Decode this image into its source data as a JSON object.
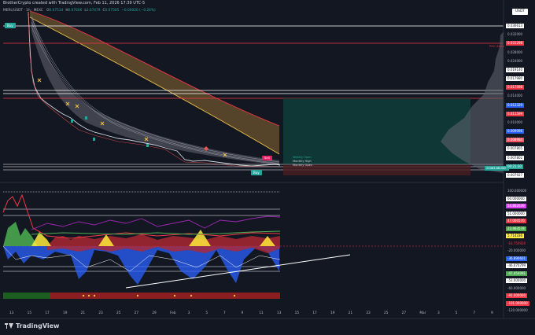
{
  "header": {
    "title": "BrotherCrypto created with TradingView.com, Feb 11, 2026 17:39 UTC-5",
    "symbol": "MERL/USDT · 1h · MEXC",
    "ohlc": [
      {
        "label": "O",
        "value": "0.07514"
      },
      {
        "label": "H",
        "value": "0.07606"
      },
      {
        "label": "L",
        "value": "0.07479"
      },
      {
        "label": "C",
        "value": "0.07505"
      },
      {
        "label": "",
        "value": "−0.00020 (−0.26%)"
      }
    ]
  },
  "scale_unit": "USDT",
  "price_axis": {
    "labels": [
      {
        "text": "0.036613",
        "bg": "#ffffff",
        "fg": "#131722"
      },
      {
        "text": "0.032000",
        "bg": "",
        "fg": "#b2b5be"
      },
      {
        "text": "0.031298",
        "bg": "#f23645",
        "fg": "#ffffff"
      },
      {
        "text": "0.028000",
        "bg": "",
        "fg": "#b2b5be"
      },
      {
        "text": "0.024000",
        "bg": "",
        "fg": "#b2b5be"
      },
      {
        "text": "0.019140",
        "bg": "#ffffff",
        "fg": "#131722"
      },
      {
        "text": "0.017980",
        "bg": "#ffffff",
        "fg": "#131722"
      },
      {
        "text": "0.017098",
        "bg": "#f23645",
        "fg": "#ffffff"
      },
      {
        "text": "0.014000",
        "bg": "",
        "fg": "#b2b5be"
      },
      {
        "text": "0.012329",
        "bg": "#2962ff",
        "fg": "#ffffff"
      },
      {
        "text": "0.011599",
        "bg": "#f23645",
        "fg": "#ffffff"
      },
      {
        "text": "0.010000",
        "bg": "",
        "fg": "#b2b5be"
      },
      {
        "text": "0.009096",
        "bg": "#2962ff",
        "fg": "#ffffff"
      },
      {
        "text": "0.008984",
        "bg": "#f7525f",
        "fg": "#ffffff"
      },
      {
        "text": "0.007805",
        "bg": "#ffffff",
        "fg": "#131722"
      },
      {
        "text": "0.007802",
        "bg": "#ffffff",
        "fg": "#131722"
      },
      {
        "text": "00:21:30",
        "bg": "#26a69a",
        "fg": "#ffffff"
      },
      {
        "text": "0.007927",
        "bg": "#ffffff",
        "fg": "#131722"
      }
    ],
    "position_label": "23363.8KUSDT"
  },
  "chart_labels": {
    "poc_label": "POC Zone",
    "weekly_open": "Weekly Open",
    "monthly_high": "Monthly High",
    "monthly_open": "Monthly Open",
    "buy_tag": "Buy",
    "sell_tag": "Sell"
  },
  "oscillator_axis": {
    "labels": [
      {
        "text": "100.000000",
        "bg": "",
        "fg": "#b2b5be"
      },
      {
        "text": "60.000000",
        "bg": "#ffffff",
        "fg": "#131722"
      },
      {
        "text": "54.862639",
        "bg": "#e040fb",
        "fg": "#ffffff"
      },
      {
        "text": "51.000000",
        "bg": "#ffffff",
        "fg": "#131722"
      },
      {
        "text": "47.000570",
        "bg": "#f23645",
        "fg": "#ffffff"
      },
      {
        "text": "23.463578",
        "bg": "#4caf50",
        "fg": "#ffffff"
      },
      {
        "text": "5.714336",
        "bg": "#ffeb3b",
        "fg": "#131722"
      },
      {
        "text": "-16.750926",
        "bg": "",
        "fg": "#f23645"
      },
      {
        "text": "-20.000000",
        "bg": "",
        "fg": "#b2b5be"
      },
      {
        "text": "-36.890601",
        "bg": "#2962ff",
        "fg": "#ffffff"
      },
      {
        "text": "-46.070799",
        "bg": "#ffffff",
        "fg": "#131722"
      },
      {
        "text": "-47.454091",
        "bg": "#4caf50",
        "fg": "#ffffff"
      },
      {
        "text": "-53.000000",
        "bg": "#ffffff",
        "fg": "#131722"
      },
      {
        "text": "-60.000000",
        "bg": "",
        "fg": "#b2b5be"
      },
      {
        "text": "-91.000000",
        "bg": "#f23645",
        "fg": "#ffffff"
      },
      {
        "text": "-101.000000",
        "bg": "#f23645",
        "fg": "#ffffff"
      },
      {
        "text": "-120.000000",
        "bg": "",
        "fg": "#b2b5be"
      }
    ]
  },
  "time_axis": [
    "13",
    "15",
    "17",
    "19",
    "21",
    "23",
    "25",
    "27",
    "29",
    "Feb",
    "3",
    "5",
    "7",
    "9",
    "11",
    "13",
    "15",
    "17",
    "19",
    "21",
    "23",
    "25",
    "27",
    "Mar",
    "3",
    "5",
    "7",
    "9"
  ],
  "brand": "TradingView",
  "colors": {
    "background": "#131722",
    "bull": "#26a69a",
    "bear": "#ef5350",
    "gold": "#f0c24b",
    "accent_red": "#f23645",
    "accent_blue": "#2962ff"
  }
}
